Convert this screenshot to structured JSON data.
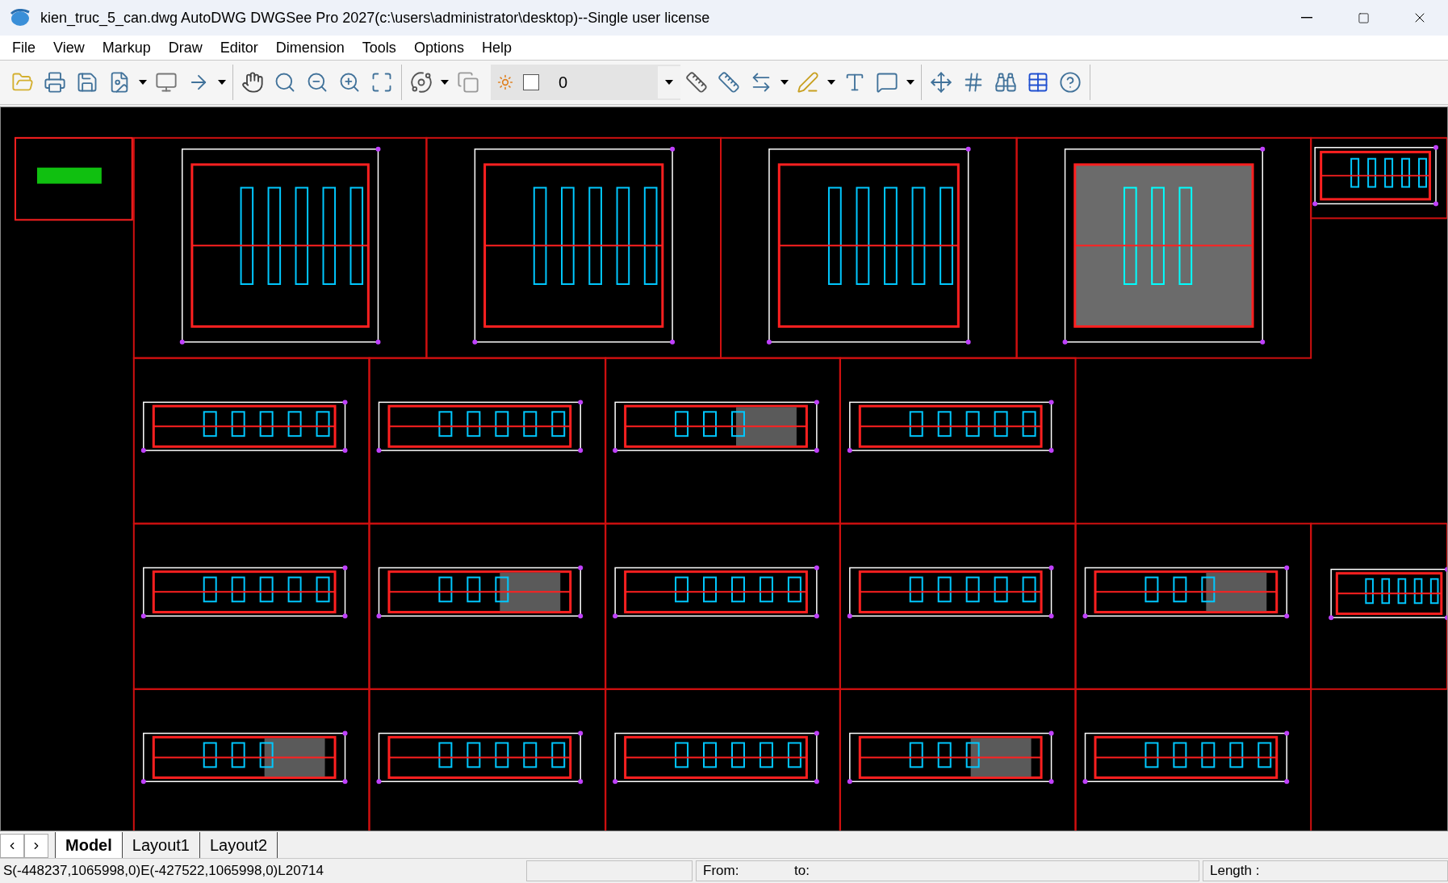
{
  "window": {
    "title": "kien_truc_5_can.dwg AutoDWG DWGSee Pro 2027(c:\\users\\administrator\\desktop)--Single user license"
  },
  "menu": [
    "File",
    "View",
    "Markup",
    "Draw",
    "Editor",
    "Dimension",
    "Tools",
    "Options",
    "Help"
  ],
  "toolbar": {
    "layer_value": "0",
    "layer_checked": false
  },
  "layout_tabs": [
    {
      "label": "Model",
      "selected": true
    },
    {
      "label": "Layout1",
      "selected": false
    },
    {
      "label": "Layout2",
      "selected": false
    }
  ],
  "status_bar": {
    "coordinates": "S(-448237,1065998,0)E(-427522,1065998,0)L20714",
    "from_label": "From:",
    "to_label": "to:",
    "length_label": "Length :"
  }
}
